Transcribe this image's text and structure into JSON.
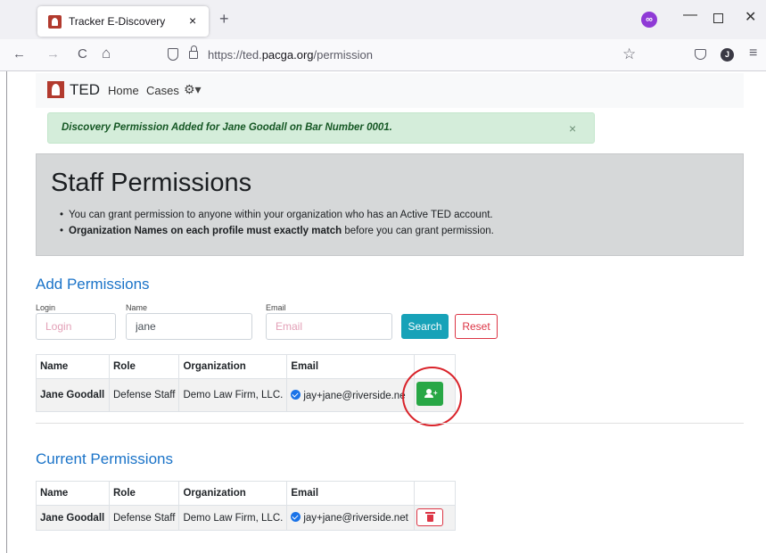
{
  "browser": {
    "tab_title": "Tracker E-Discovery",
    "tab_close": "×",
    "new_tab": "+",
    "nav_back": "←",
    "nav_forward": "→",
    "nav_reload": "C",
    "nav_home": "⌂",
    "url_prefix": "https://ted.",
    "url_domain": "pacga.org",
    "url_path": "/permission",
    "bookmark": "☆",
    "extension": "∞",
    "account": "J",
    "menu": "≡",
    "win_min": "—",
    "win_close": "✕"
  },
  "app_nav": {
    "brand": "TED",
    "home": "Home",
    "cases": "Cases",
    "settings": "⚙▾"
  },
  "alert": {
    "text": "Discovery Permission Added for Jane Goodall on Bar Number 0001.",
    "close": "×"
  },
  "jumbotron": {
    "title": "Staff Permissions",
    "bullet1": "You can grant permission to anyone within your organization who has an Active TED account.",
    "bullet2_bold": "Organization Names on each profile must exactly match",
    "bullet2_rest": " before you can grant permission."
  },
  "add_permissions": {
    "title": "Add Permissions",
    "login_label": "Login",
    "login_placeholder": "Login",
    "name_label": "Name",
    "name_value": "jane",
    "email_label": "Email",
    "email_placeholder": "Email",
    "search_label": "Search",
    "reset_label": "Reset",
    "columns": [
      "Name",
      "Role",
      "Organization",
      "Email",
      ""
    ],
    "row": {
      "name": "Jane Goodall",
      "role": "Defense Staff",
      "organization": "Demo Law Firm, LLC.",
      "email": "jay+jane@riverside.ne"
    }
  },
  "current_permissions": {
    "title": "Current Permissions",
    "columns": [
      "Name",
      "Role",
      "Organization",
      "Email",
      ""
    ],
    "row": {
      "name": "Jane Goodall",
      "role": "Defense Staff",
      "organization": "Demo Law Firm, LLC.",
      "email": "jay+jane@riverside.net"
    }
  },
  "colors": {
    "accent_blue": "#1a73c8",
    "success": "#28a745",
    "danger": "#dc3545",
    "info": "#17a2b8",
    "highlight": "#d9232a"
  }
}
